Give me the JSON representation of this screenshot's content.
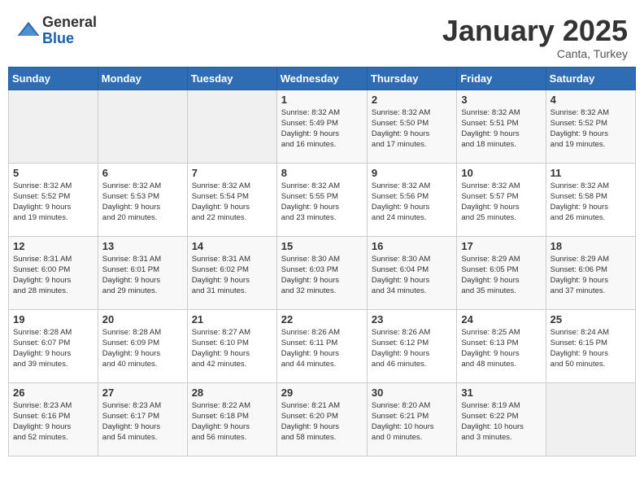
{
  "header": {
    "logo_general": "General",
    "logo_blue": "Blue",
    "month": "January 2025",
    "location": "Canta, Turkey"
  },
  "days_of_week": [
    "Sunday",
    "Monday",
    "Tuesday",
    "Wednesday",
    "Thursday",
    "Friday",
    "Saturday"
  ],
  "weeks": [
    [
      {
        "day": "",
        "info": ""
      },
      {
        "day": "",
        "info": ""
      },
      {
        "day": "",
        "info": ""
      },
      {
        "day": "1",
        "info": "Sunrise: 8:32 AM\nSunset: 5:49 PM\nDaylight: 9 hours\nand 16 minutes."
      },
      {
        "day": "2",
        "info": "Sunrise: 8:32 AM\nSunset: 5:50 PM\nDaylight: 9 hours\nand 17 minutes."
      },
      {
        "day": "3",
        "info": "Sunrise: 8:32 AM\nSunset: 5:51 PM\nDaylight: 9 hours\nand 18 minutes."
      },
      {
        "day": "4",
        "info": "Sunrise: 8:32 AM\nSunset: 5:52 PM\nDaylight: 9 hours\nand 19 minutes."
      }
    ],
    [
      {
        "day": "5",
        "info": "Sunrise: 8:32 AM\nSunset: 5:52 PM\nDaylight: 9 hours\nand 19 minutes."
      },
      {
        "day": "6",
        "info": "Sunrise: 8:32 AM\nSunset: 5:53 PM\nDaylight: 9 hours\nand 20 minutes."
      },
      {
        "day": "7",
        "info": "Sunrise: 8:32 AM\nSunset: 5:54 PM\nDaylight: 9 hours\nand 22 minutes."
      },
      {
        "day": "8",
        "info": "Sunrise: 8:32 AM\nSunset: 5:55 PM\nDaylight: 9 hours\nand 23 minutes."
      },
      {
        "day": "9",
        "info": "Sunrise: 8:32 AM\nSunset: 5:56 PM\nDaylight: 9 hours\nand 24 minutes."
      },
      {
        "day": "10",
        "info": "Sunrise: 8:32 AM\nSunset: 5:57 PM\nDaylight: 9 hours\nand 25 minutes."
      },
      {
        "day": "11",
        "info": "Sunrise: 8:32 AM\nSunset: 5:58 PM\nDaylight: 9 hours\nand 26 minutes."
      }
    ],
    [
      {
        "day": "12",
        "info": "Sunrise: 8:31 AM\nSunset: 6:00 PM\nDaylight: 9 hours\nand 28 minutes."
      },
      {
        "day": "13",
        "info": "Sunrise: 8:31 AM\nSunset: 6:01 PM\nDaylight: 9 hours\nand 29 minutes."
      },
      {
        "day": "14",
        "info": "Sunrise: 8:31 AM\nSunset: 6:02 PM\nDaylight: 9 hours\nand 31 minutes."
      },
      {
        "day": "15",
        "info": "Sunrise: 8:30 AM\nSunset: 6:03 PM\nDaylight: 9 hours\nand 32 minutes."
      },
      {
        "day": "16",
        "info": "Sunrise: 8:30 AM\nSunset: 6:04 PM\nDaylight: 9 hours\nand 34 minutes."
      },
      {
        "day": "17",
        "info": "Sunrise: 8:29 AM\nSunset: 6:05 PM\nDaylight: 9 hours\nand 35 minutes."
      },
      {
        "day": "18",
        "info": "Sunrise: 8:29 AM\nSunset: 6:06 PM\nDaylight: 9 hours\nand 37 minutes."
      }
    ],
    [
      {
        "day": "19",
        "info": "Sunrise: 8:28 AM\nSunset: 6:07 PM\nDaylight: 9 hours\nand 39 minutes."
      },
      {
        "day": "20",
        "info": "Sunrise: 8:28 AM\nSunset: 6:09 PM\nDaylight: 9 hours\nand 40 minutes."
      },
      {
        "day": "21",
        "info": "Sunrise: 8:27 AM\nSunset: 6:10 PM\nDaylight: 9 hours\nand 42 minutes."
      },
      {
        "day": "22",
        "info": "Sunrise: 8:26 AM\nSunset: 6:11 PM\nDaylight: 9 hours\nand 44 minutes."
      },
      {
        "day": "23",
        "info": "Sunrise: 8:26 AM\nSunset: 6:12 PM\nDaylight: 9 hours\nand 46 minutes."
      },
      {
        "day": "24",
        "info": "Sunrise: 8:25 AM\nSunset: 6:13 PM\nDaylight: 9 hours\nand 48 minutes."
      },
      {
        "day": "25",
        "info": "Sunrise: 8:24 AM\nSunset: 6:15 PM\nDaylight: 9 hours\nand 50 minutes."
      }
    ],
    [
      {
        "day": "26",
        "info": "Sunrise: 8:23 AM\nSunset: 6:16 PM\nDaylight: 9 hours\nand 52 minutes."
      },
      {
        "day": "27",
        "info": "Sunrise: 8:23 AM\nSunset: 6:17 PM\nDaylight: 9 hours\nand 54 minutes."
      },
      {
        "day": "28",
        "info": "Sunrise: 8:22 AM\nSunset: 6:18 PM\nDaylight: 9 hours\nand 56 minutes."
      },
      {
        "day": "29",
        "info": "Sunrise: 8:21 AM\nSunset: 6:20 PM\nDaylight: 9 hours\nand 58 minutes."
      },
      {
        "day": "30",
        "info": "Sunrise: 8:20 AM\nSunset: 6:21 PM\nDaylight: 10 hours\nand 0 minutes."
      },
      {
        "day": "31",
        "info": "Sunrise: 8:19 AM\nSunset: 6:22 PM\nDaylight: 10 hours\nand 3 minutes."
      },
      {
        "day": "",
        "info": ""
      }
    ]
  ]
}
